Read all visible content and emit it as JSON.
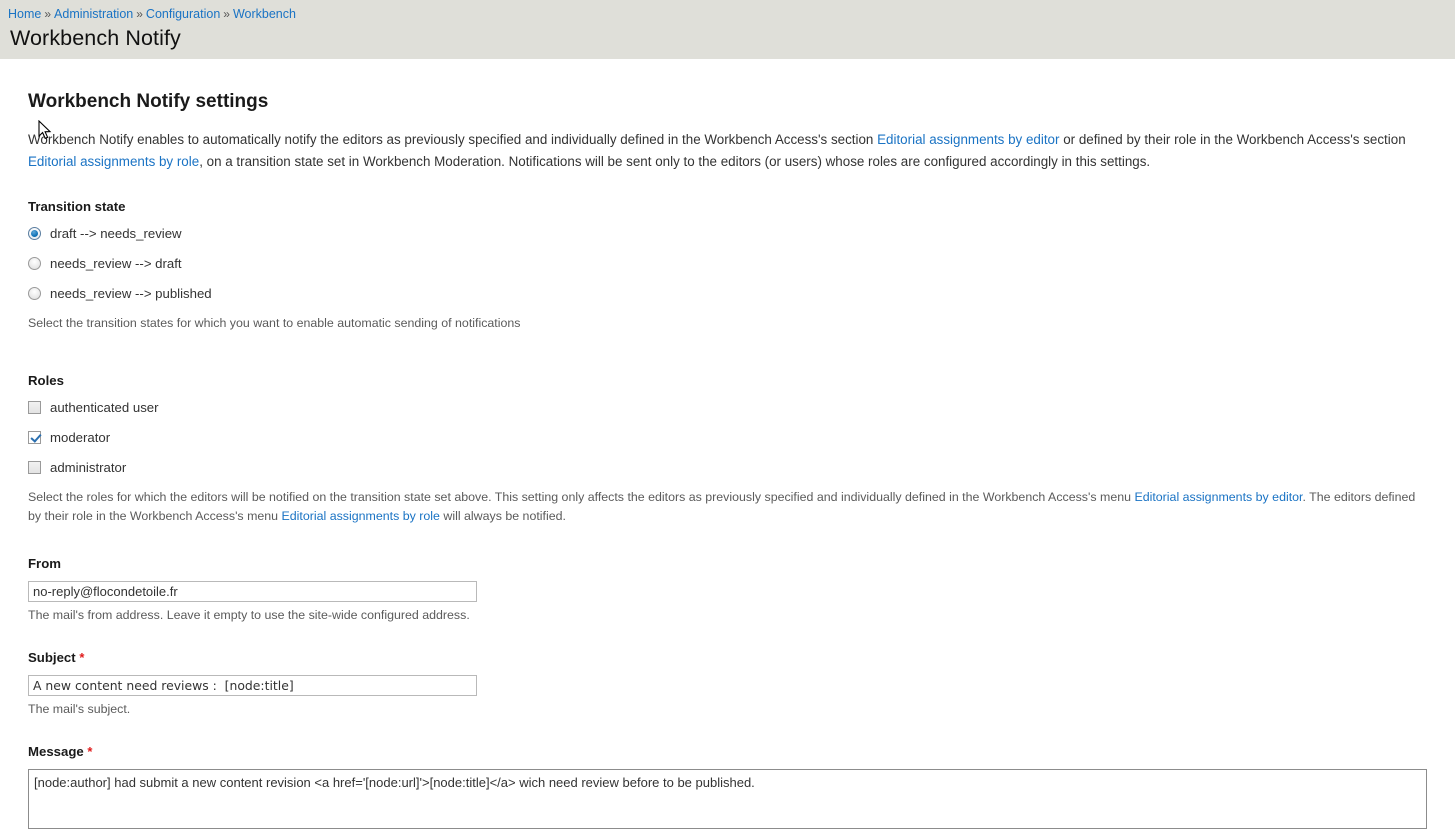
{
  "header": {
    "breadcrumb": [
      {
        "label": "Home",
        "link": true
      },
      {
        "label": "Administration",
        "link": true
      },
      {
        "label": "Configuration",
        "link": true
      },
      {
        "label": "Workbench",
        "link": true
      }
    ],
    "separator": "»",
    "title": "Workbench Notify"
  },
  "main": {
    "section_title": "Workbench Notify settings",
    "intro": {
      "part1": "Workbench Notify enables to automatically notify the editors as previously specified and individually defined in the Workbench Access's section ",
      "link1": "Editorial assignments by editor",
      "part2": " or defined by their role in the Workbench Access's section ",
      "link2": "Editorial assignments by role",
      "part3": ", on a transition state set in Workbench Moderation. Notifications will be sent only to the editors (or users) whose roles are configured accordingly in this settings."
    },
    "transition": {
      "label": "Transition state",
      "options": [
        {
          "label": "draft --> needs_review",
          "checked": true
        },
        {
          "label": "needs_review --> draft",
          "checked": false
        },
        {
          "label": "needs_review --> published",
          "checked": false
        }
      ],
      "description": "Select the transition states for which you want to enable automatic sending of notifications"
    },
    "roles": {
      "label": "Roles",
      "options": [
        {
          "label": "authenticated user",
          "checked": false
        },
        {
          "label": "moderator",
          "checked": true
        },
        {
          "label": "administrator",
          "checked": false
        }
      ],
      "description": {
        "part1": "Select the roles for which the editors will be notified on the transition state set above. This setting only affects the editors as previously specified and individually defined in the Workbench Access's menu ",
        "link1": "Editorial assignments by editor",
        "part2": ". The editors defined by their role in the Workbench Access's menu ",
        "link2": "Editorial assignments by role",
        "part3": " will always be notified."
      }
    },
    "from": {
      "label": "From",
      "value": "no-reply@flocondetoile.fr",
      "placeholder": "",
      "description": "The mail's from address. Leave it empty to use the site-wide configured address."
    },
    "subject": {
      "label": "Subject",
      "required_marker": "*",
      "value": "A new content need reviews :  [node:title]",
      "placeholder": "",
      "description": "The mail's subject."
    },
    "message": {
      "label": "Message",
      "required_marker": "*",
      "value": "[node:author] had submit a new content revision <a href='[node:url]'>[node:title]</a> wich need review before to be published.",
      "placeholder": ""
    }
  },
  "colors": {
    "header_bg": "#dfdfd9",
    "link": "#1a73c4",
    "required": "#e01b1b",
    "accent_checked": "#1173b8"
  }
}
